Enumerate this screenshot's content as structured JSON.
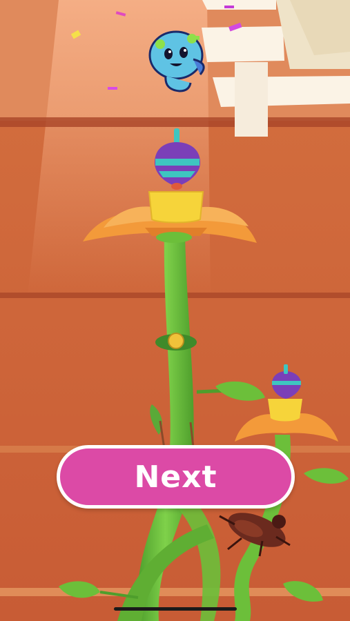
{
  "screen": {
    "name": "level-complete"
  },
  "controls": {
    "next_label": "Next"
  },
  "scene": {
    "objects": [
      "wall-panels",
      "window-blinds",
      "blue-creature",
      "spinning-top",
      "flower",
      "beanstalk",
      "second-flower",
      "beetle",
      "confetti"
    ],
    "colors": {
      "wall": "#c9643d",
      "wall_trim": "#b34a2a",
      "light_beam": "#f2a47a",
      "stem": "#6cbf3a",
      "petal": "#f39a3a",
      "cup": "#f6d43a",
      "top_purple": "#7b3fb8",
      "top_teal": "#3ec6c0",
      "creature": "#5fc3e4",
      "button": "#dc4aa6"
    }
  }
}
